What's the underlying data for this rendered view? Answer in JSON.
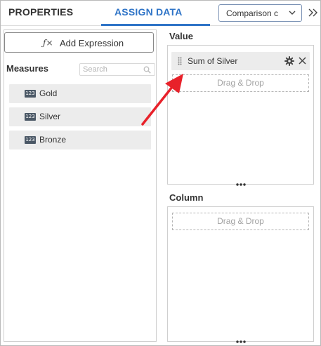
{
  "header": {
    "tabs": [
      {
        "label": "PROPERTIES",
        "active": false
      },
      {
        "label": "ASSIGN DATA",
        "active": true
      }
    ],
    "chart_type_select": {
      "value": "Comparison c"
    },
    "accent_color": "#2f74c7"
  },
  "left_panel": {
    "add_expression": {
      "icon": "function-icon",
      "label": "Add Expression"
    },
    "measures_title": "Measures",
    "search": {
      "placeholder": "Search",
      "value": ""
    },
    "measures": [
      {
        "type_badge": "123",
        "label": "Gold"
      },
      {
        "type_badge": "123",
        "label": "Silver"
      },
      {
        "type_badge": "123",
        "label": "Bronze"
      }
    ]
  },
  "right_panel": {
    "sections": [
      {
        "title": "Value",
        "items": [
          {
            "label": "Sum of Silver"
          }
        ],
        "drop_text": "Drag & Drop"
      },
      {
        "title": "Column",
        "items": [],
        "drop_text": "Drag & Drop"
      }
    ]
  },
  "annotation": {
    "arrow_color": "#e8212a"
  }
}
